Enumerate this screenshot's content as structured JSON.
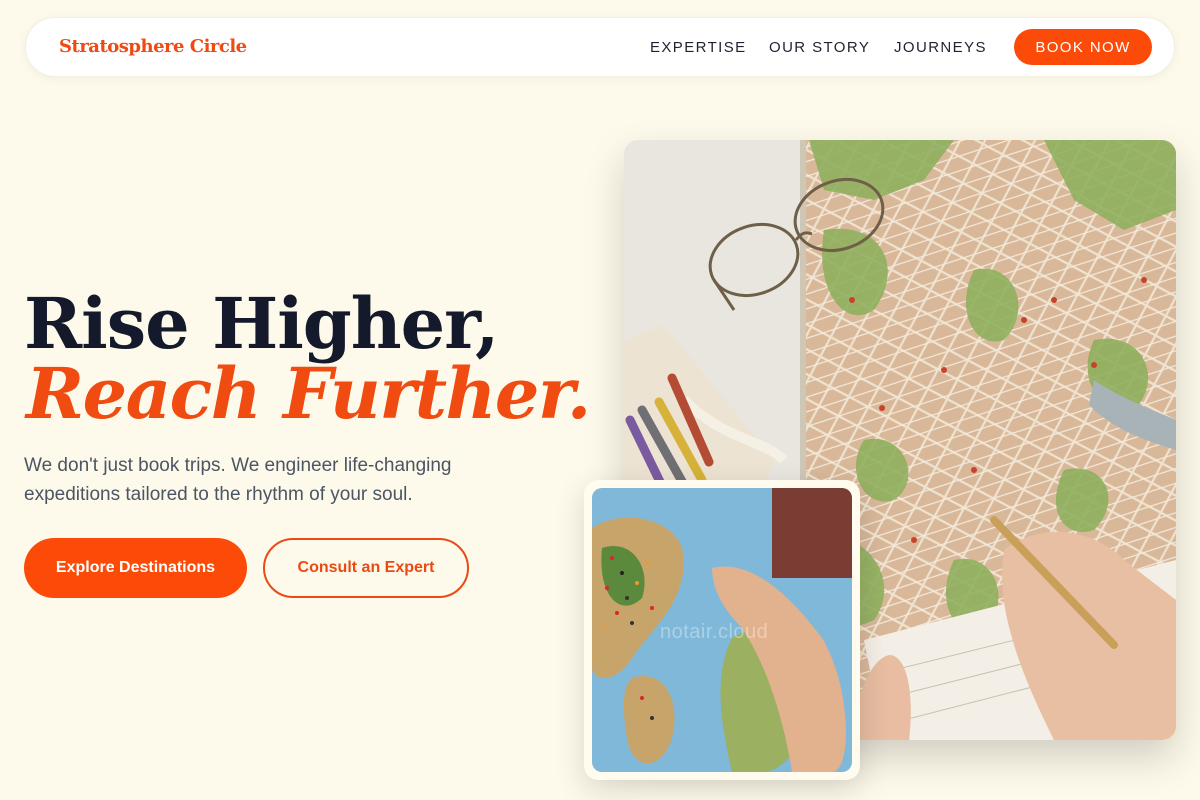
{
  "brand": {
    "name": "Stratosphere Circle",
    "accent": "#fc4b08"
  },
  "nav": {
    "links": [
      "EXPERTISE",
      "OUR STORY",
      "JOURNEYS"
    ],
    "cta": "BOOK NOW"
  },
  "hero": {
    "heading_line1": "Rise Higher,",
    "heading_line2": "Reach Further.",
    "subtitle": "We don't just book trips. We engineer life-changing expeditions tailored to the rhythm of your soul.",
    "primary_cta": "Explore Destinations",
    "secondary_cta": "Consult an Expert",
    "main_image": "map-with-glasses-pencils-pen-photo",
    "inset_image": "pinned-world-map-photo",
    "watermark": "notair.cloud"
  }
}
